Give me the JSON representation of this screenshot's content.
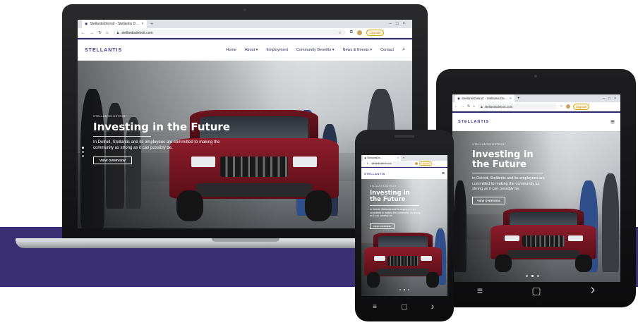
{
  "browser": {
    "tab_title": "StellantisDetroit - Stellantis Detroit",
    "tab_title_short": "StellantisDe...",
    "url": "stellantisdetroit.com",
    "url_tablet": "stellantisdetroit.com",
    "url_phone": "stellantisdetroit.com",
    "upgrade_label": "Upgrade",
    "new_tab": "+",
    "close": "×",
    "min": "–",
    "max": "□"
  },
  "site": {
    "logo": "STELLANTIS",
    "menu": [
      "Home",
      "About",
      "Employment",
      "Community Benefits",
      "News & Events",
      "Contact"
    ],
    "eyebrow": "STELLANTIS DETROIT",
    "headline": "Investing in the Future",
    "headline_line1": "Investing in",
    "headline_line2": "the Future",
    "body": "In Detroit, Stellantis and its employees are committed to making the community as strong as it can possibly be.",
    "cta": "VIEW OVERVIEW"
  },
  "icons": {
    "search": "search-icon",
    "hamburger": "hamburger-icon",
    "back": "back-icon",
    "forward": "forward-icon",
    "reload": "reload-icon",
    "home": "home-icon",
    "star": "star-icon"
  },
  "colors": {
    "brand_navy": "#2d2a6e",
    "band_purple": "#3b2f73",
    "jeep_red": "#8e1d2b"
  },
  "navkeys": {
    "menu": "≡",
    "home": "▢",
    "back": "›"
  }
}
